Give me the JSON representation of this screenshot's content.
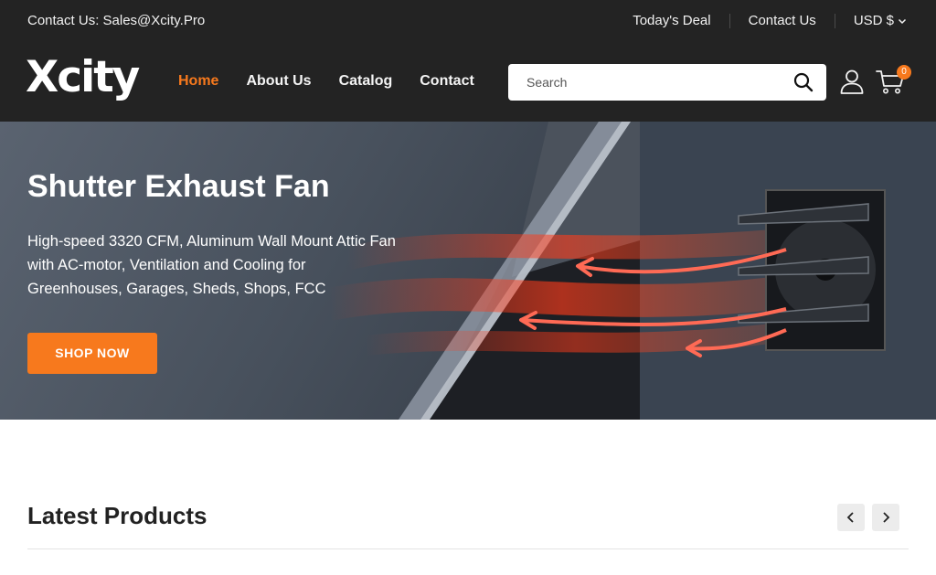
{
  "topbar": {
    "contact": "Contact Us: Sales@Xcity.Pro",
    "links": [
      "Today's Deal",
      "Contact Us"
    ],
    "currency": "USD $"
  },
  "brand": {
    "logo_text": "Xcity"
  },
  "nav": {
    "items": [
      {
        "label": "Home",
        "active": true
      },
      {
        "label": "About Us",
        "active": false
      },
      {
        "label": "Catalog",
        "active": false
      },
      {
        "label": "Contact",
        "active": false
      }
    ]
  },
  "search": {
    "placeholder": "Search",
    "value": ""
  },
  "cart": {
    "count": "0"
  },
  "hero": {
    "title": "Shutter Exhaust Fan",
    "description": "High-speed 3320 CFM, Aluminum Wall Mount Attic Fan with AC-motor, Ventilation and Cooling for Greenhouses, Garages, Sheds, Shops, FCC",
    "button": "SHOP NOW"
  },
  "latest": {
    "title": "Latest Products"
  },
  "colors": {
    "header_bg": "#232323",
    "accent": "#f7791d",
    "text_light": "#f2f2f2"
  },
  "icons": [
    "chevron-down-icon",
    "search-icon",
    "user-icon",
    "cart-icon",
    "chevron-left-icon",
    "chevron-right-icon"
  ]
}
